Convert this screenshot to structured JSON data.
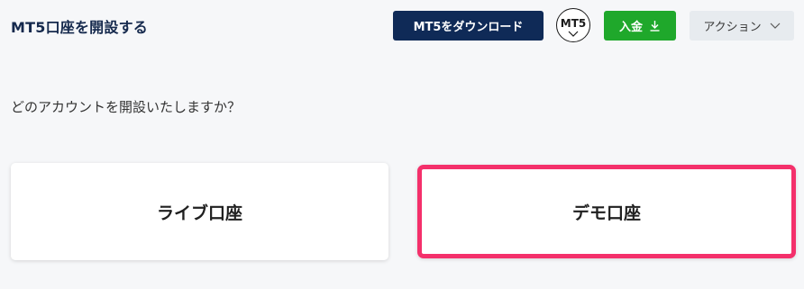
{
  "header": {
    "title": "MT5口座を開設する",
    "download_button": "MT5をダウンロード",
    "platform_badge": "MT5",
    "deposit_button": "入金",
    "action_button": "アクション"
  },
  "main": {
    "question": "どのアカウントを開設いたしますか？",
    "options": [
      {
        "label": "ライブ口座"
      },
      {
        "label": "デモ口座",
        "highlighted": true
      }
    ]
  },
  "colors": {
    "navy": "#0f2a57",
    "green": "#1fa82b",
    "highlight": "#f4306b",
    "action_bg": "#e7ebef"
  },
  "icons": {
    "badge_chevron": "chevron-down-icon",
    "deposit": "download-icon",
    "action": "chevron-down-icon"
  }
}
